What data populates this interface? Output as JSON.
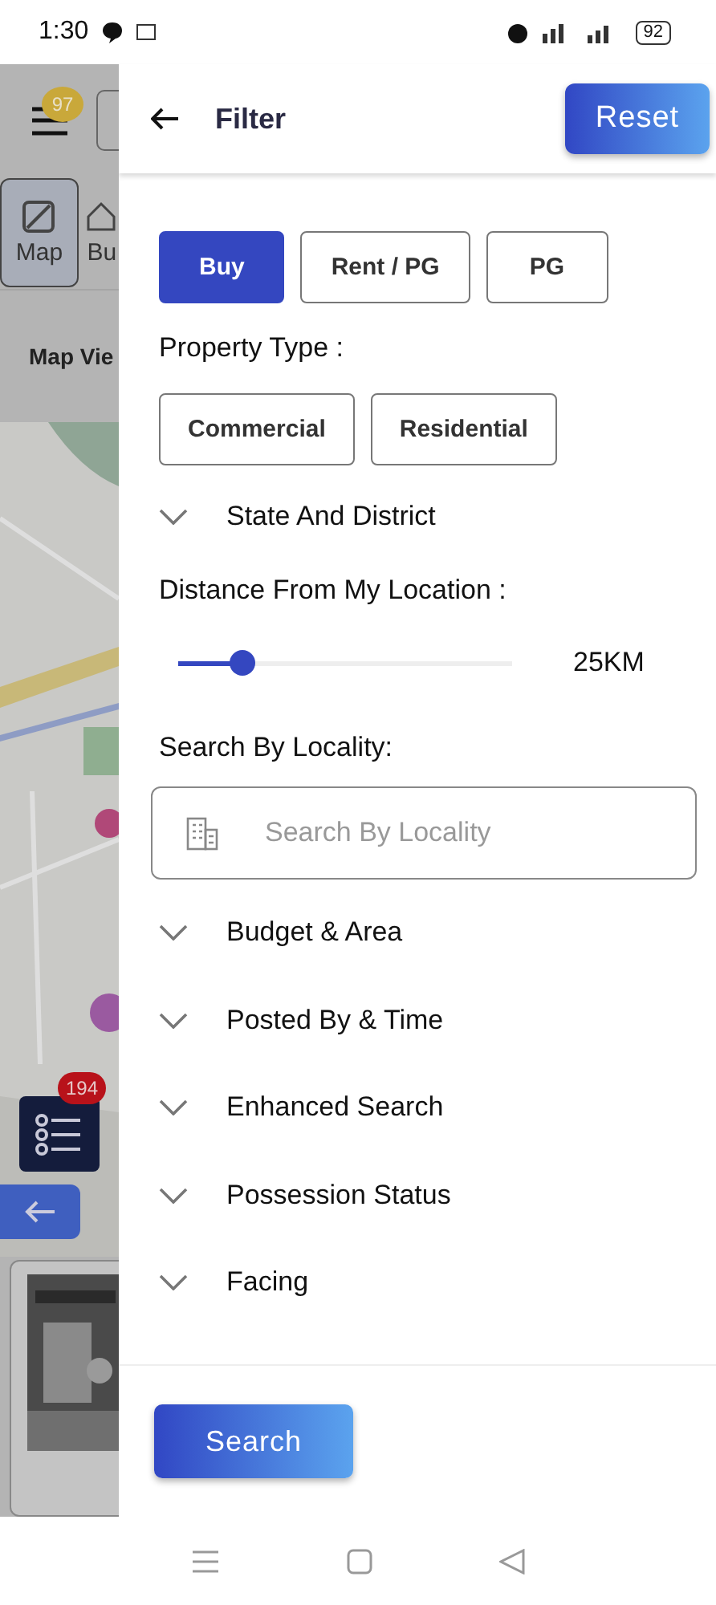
{
  "status_bar": {
    "time": "1:30",
    "battery": "92"
  },
  "background_app": {
    "badge": "97",
    "tabs": [
      {
        "label": "Map",
        "selected": true
      },
      {
        "label": "Bu",
        "selected": false
      }
    ],
    "view_title": "Map Vie",
    "list_badge": "194"
  },
  "filter": {
    "title": "Filter",
    "reset": "Reset",
    "listing_types": [
      {
        "label": "Buy",
        "selected": true
      },
      {
        "label": "Rent / PG",
        "selected": false
      },
      {
        "label": "PG",
        "selected": false
      }
    ],
    "property_type_label": "Property Type :",
    "property_types": [
      {
        "label": "Commercial",
        "selected": false
      },
      {
        "label": "Residential",
        "selected": false
      }
    ],
    "state_section": {
      "label": "State And District",
      "expanded": false
    },
    "distance_label": "Distance From My Location :",
    "distance": {
      "level": 0.19,
      "reading": "25KM"
    },
    "locality_label": "Search By Locality:",
    "locality_search": {
      "placeholder": "Search By Locality"
    },
    "sections": [
      {
        "label": "Budget & Area",
        "expanded": false
      },
      {
        "label": "Posted By & Time",
        "expanded": false
      },
      {
        "label": "Enhanced Search",
        "expanded": false
      },
      {
        "label": "Possession Status",
        "expanded": false
      },
      {
        "label": "Facing",
        "expanded": false
      }
    ],
    "search_button": "Search"
  }
}
